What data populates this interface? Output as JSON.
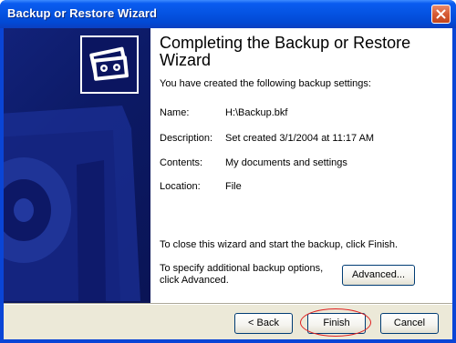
{
  "window": {
    "title": "Backup or Restore Wizard"
  },
  "titlebar": {
    "close_icon": "close-icon"
  },
  "left_panel": {
    "icon": "backup-tape-icon"
  },
  "main": {
    "heading": "Completing the Backup or Restore Wizard",
    "subtitle": "You have created the following backup settings:",
    "settings": [
      {
        "label": "Name:",
        "value": "H:\\Backup.bkf"
      },
      {
        "label": "Description:",
        "value": "Set created 3/1/2004 at 11:17 AM"
      },
      {
        "label": "Contents:",
        "value": "My documents and settings"
      },
      {
        "label": "Location:",
        "value": "File"
      }
    ],
    "instruction": "To close this wizard and start the backup, click Finish.",
    "options_text": "To specify additional backup options, click Advanced.",
    "advanced_label": "Advanced..."
  },
  "footer": {
    "back_label": "< Back",
    "finish_label": "Finish",
    "cancel_label": "Cancel"
  },
  "colors": {
    "titlebar": "#0554e3",
    "panel": "#0c1a66",
    "dialog_bg": "#ece9d8",
    "highlight": "#e02020"
  }
}
